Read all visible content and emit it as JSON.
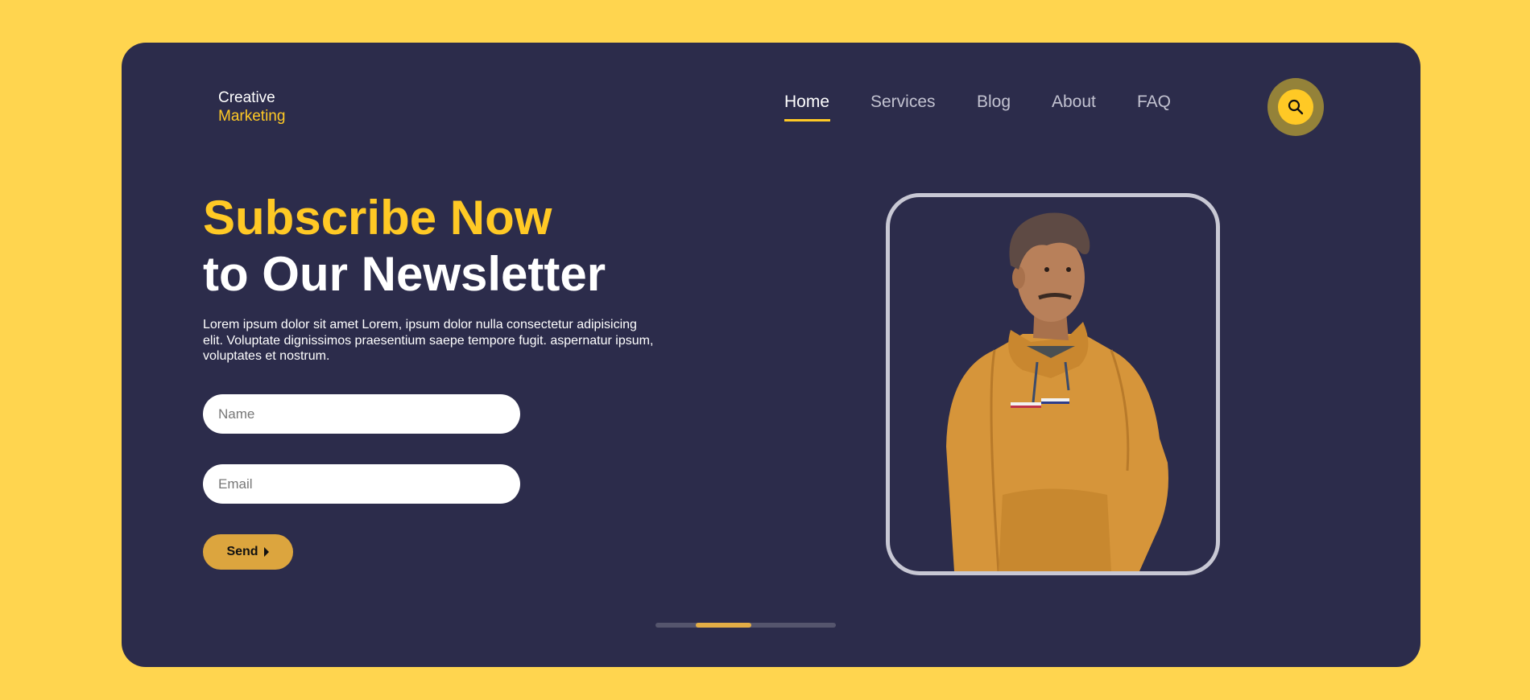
{
  "logo": {
    "line1": "Creative",
    "line2": "Marketing"
  },
  "nav": {
    "items": [
      {
        "label": "Home",
        "active": true
      },
      {
        "label": "Services",
        "active": false
      },
      {
        "label": "Blog",
        "active": false
      },
      {
        "label": "About",
        "active": false
      },
      {
        "label": "FAQ",
        "active": false
      }
    ]
  },
  "search": {
    "icon": "search-icon"
  },
  "hero": {
    "title_line1": "Subscribe Now",
    "title_line2": "to Our Newsletter",
    "description": "Lorem ipsum dolor sit amet Lorem, ipsum dolor nulla consectetur adipisicing elit. Voluptate dignissimos praesentium saepe tempore fugit. aspernatur ipsum, voluptates et nostrum.",
    "form": {
      "name_placeholder": "Name",
      "email_placeholder": "Email",
      "send_label": "Send"
    }
  },
  "carousel": {
    "slides": 3,
    "active_index": 1
  },
  "colors": {
    "background": "#ffd54f",
    "card": "#2c2c4b",
    "accent": "#ffc925",
    "button": "#dca53e"
  }
}
